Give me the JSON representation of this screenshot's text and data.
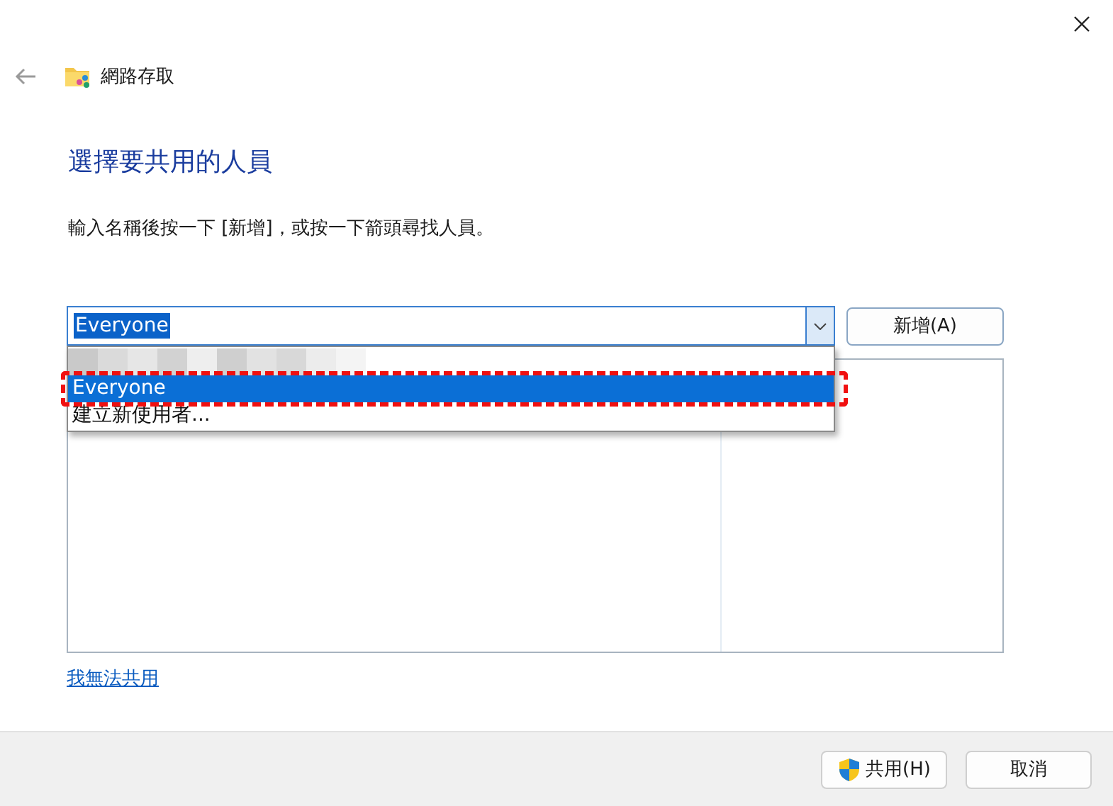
{
  "window": {
    "title": "網路存取"
  },
  "heading": "選擇要共用的人員",
  "instruction": "輸入名稱後按一下 [新增]，或按一下箭頭尋找人員。",
  "combo": {
    "value": "Everyone",
    "expanded": true
  },
  "add_button": "新增(A)",
  "dropdown": {
    "items": [
      {
        "kind": "redacted"
      },
      {
        "kind": "option",
        "label": "Everyone",
        "selected": true,
        "highlighted": true
      },
      {
        "kind": "option",
        "label": "建立新使用者...",
        "selected": false,
        "highlighted": false
      }
    ]
  },
  "link": "我無法共用",
  "buttons": [
    {
      "kind": "shield",
      "label": "共用(H)"
    },
    {
      "kind": "plain",
      "label": "取消"
    }
  ]
}
